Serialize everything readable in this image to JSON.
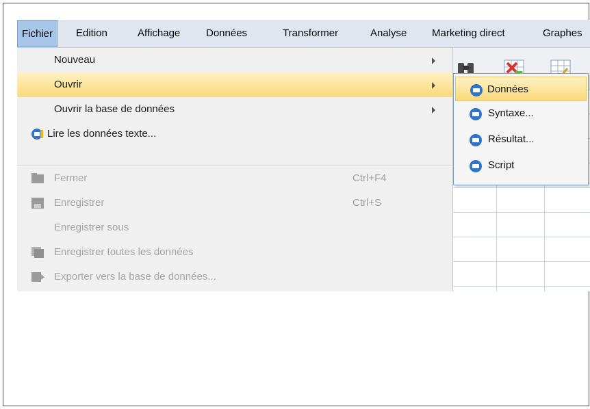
{
  "menubar": {
    "items": [
      "Fichier",
      "Edition",
      "Affichage",
      "Données",
      "Transformer",
      "Analyse",
      "Marketing direct",
      "Graphes"
    ]
  },
  "file_menu": {
    "items": [
      {
        "label": "Nouveau",
        "has_submenu": true
      },
      {
        "label": "Ouvrir",
        "has_submenu": true
      },
      {
        "label": "Ouvrir la base de données",
        "has_submenu": true
      },
      {
        "label": "Lire les données texte..."
      },
      {
        "label": "Fermer",
        "shortcut": "Ctrl+F4",
        "disabled": true
      },
      {
        "label": "Enregistrer",
        "shortcut": "Ctrl+S",
        "disabled": true
      },
      {
        "label": "Enregistrer sous",
        "disabled": true
      },
      {
        "label": "Enregistrer toutes les données",
        "disabled": true
      },
      {
        "label": "Exporter vers la base de données...",
        "disabled": true
      }
    ]
  },
  "open_submenu": {
    "items": [
      "Données",
      "Syntaxe...",
      "Résultat...",
      "Script"
    ]
  },
  "colors": {
    "menubar_bg": "#dfe6ef",
    "highlight": "#fbd97a",
    "disabled_text": "#a4a4a4",
    "submenu_border": "#7aa3cc"
  }
}
